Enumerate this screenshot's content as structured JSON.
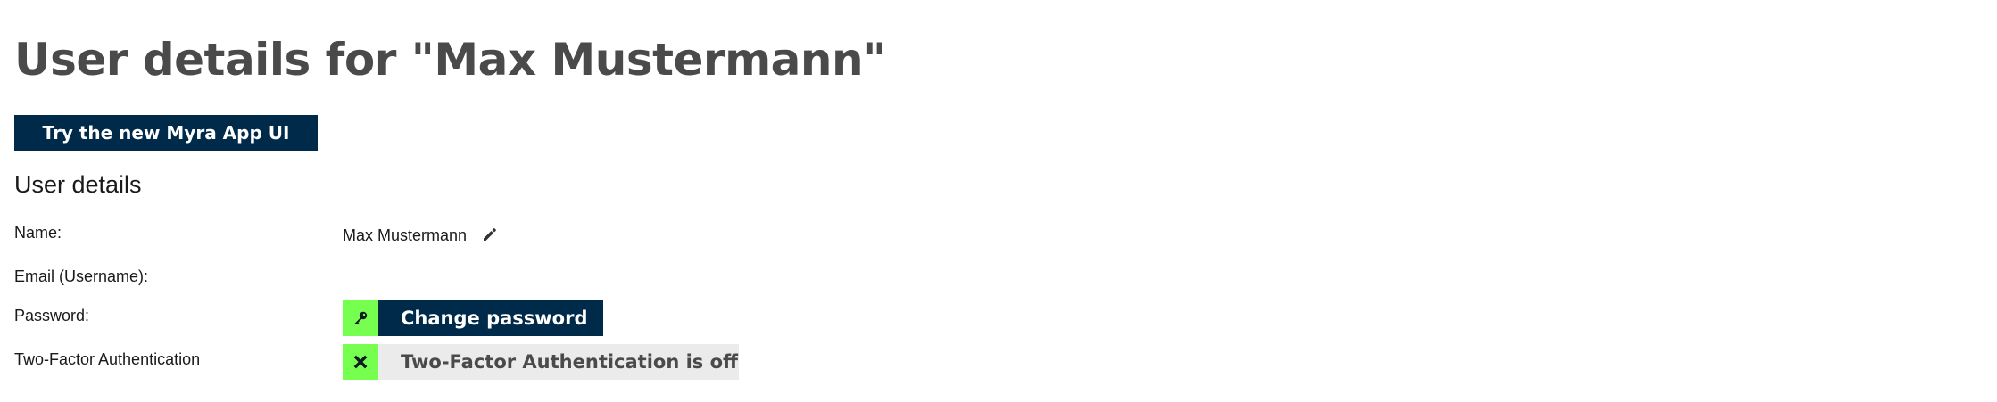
{
  "page": {
    "title": "User details for \"Max Mustermann\""
  },
  "toolbar": {
    "try_new_ui_label": "Try the new Myra App UI"
  },
  "user_details": {
    "heading": "User details",
    "fields": {
      "name_label": "Name:",
      "name_value": "Max Mustermann",
      "email_label": "Email (Username):",
      "password_label": "Password:",
      "two_factor_label": "Two-Factor Authentication"
    },
    "buttons": {
      "change_password_label": "Change password",
      "change_password_icon": "key-icon",
      "two_factor_label": "Two-Factor Authentication is off",
      "two_factor_icon": "close-icon"
    }
  },
  "colors": {
    "title": "#4a4a4a",
    "primary": "#002a4a",
    "accent_green": "#77ff4f",
    "neutral_button": "#ebebeb"
  },
  "icons": {
    "edit": "pencil-icon"
  }
}
